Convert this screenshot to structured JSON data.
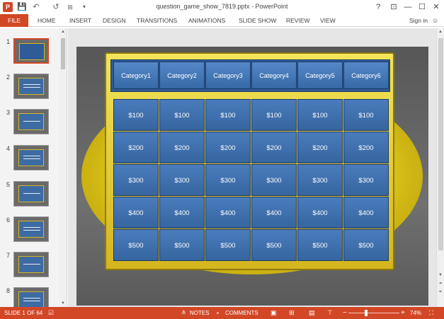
{
  "app": {
    "title": "question_game_show_7819.pptx - PowerPoint",
    "logo_letter": "P",
    "accent_color": "#d24726"
  },
  "window_controls": {
    "help": "?",
    "restore_ribbon": "⊡",
    "minimize": "—",
    "maximize": "☐",
    "close": "✕"
  },
  "quick_access": {
    "save_icon": "💾",
    "undo_icon": "↶",
    "redo_icon": "↺",
    "customize_icon": "▾"
  },
  "ribbon": {
    "tabs": [
      "FILE",
      "HOME",
      "INSERT",
      "DESIGN",
      "TRANSITIONS",
      "ANIMATIONS",
      "SLIDE SHOW",
      "REVIEW",
      "VIEW"
    ],
    "sign_in": "Sign in"
  },
  "thumbnails": {
    "numbers": [
      "1",
      "2",
      "3",
      "4",
      "5",
      "6",
      "7",
      "8"
    ],
    "active_index": 0
  },
  "board": {
    "categories": [
      "Category1",
      "Category2",
      "Category3",
      "Category4",
      "Category5",
      "Category6"
    ],
    "rows": [
      [
        "$100",
        "$100",
        "$100",
        "$100",
        "$100",
        "$100"
      ],
      [
        "$200",
        "$200",
        "$200",
        "$200",
        "$200",
        "$200"
      ],
      [
        "$300",
        "$300",
        "$300",
        "$300",
        "$300",
        "$300"
      ],
      [
        "$400",
        "$400",
        "$400",
        "$400",
        "$400",
        "$400"
      ],
      [
        "$500",
        "$500",
        "$500",
        "$500",
        "$500",
        "$500"
      ]
    ]
  },
  "statusbar": {
    "slide_info": "SLIDE 1 OF 64",
    "notes": "NOTES",
    "comments": "COMMENTS",
    "zoom": "74%",
    "zoom_minus": "−",
    "zoom_plus": "+"
  }
}
